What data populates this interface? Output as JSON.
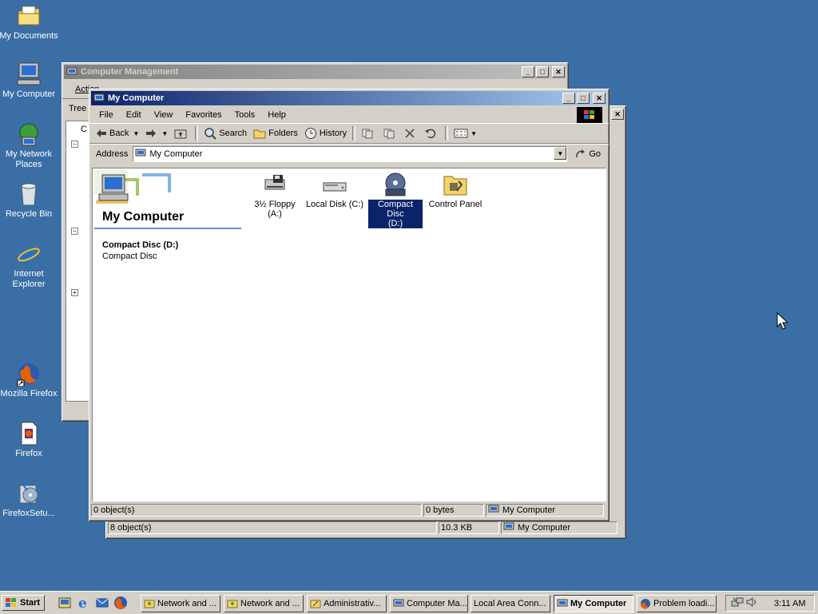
{
  "desktop": {
    "icons": [
      {
        "label": "My Documents",
        "icon": "folder-documents-icon"
      },
      {
        "label": "My Computer",
        "icon": "computer-icon"
      },
      {
        "label": "My Network Places",
        "icon": "network-places-icon"
      },
      {
        "label": "Recycle Bin",
        "icon": "recycle-bin-icon"
      },
      {
        "label": "Internet Explorer",
        "icon": "internet-explorer-icon"
      },
      {
        "label": "Mozilla Firefox",
        "icon": "firefox-icon"
      },
      {
        "label": "Firefox",
        "icon": "firefox-file-icon"
      },
      {
        "label": "FirefoxSetu...",
        "icon": "setup-icon"
      }
    ]
  },
  "computer_management": {
    "title": "Computer Management",
    "toolbar_partial": "Action",
    "tree_label": "Tree",
    "tree_first": "C",
    "status": {
      "objects": "8 object(s)",
      "size": "10.3 KB",
      "location": "My Computer"
    }
  },
  "my_computer": {
    "title": "My Computer",
    "menu": [
      "File",
      "Edit",
      "View",
      "Favorites",
      "Tools",
      "Help"
    ],
    "toolbar": {
      "back": "Back",
      "search": "Search",
      "folders": "Folders",
      "history": "History"
    },
    "address_label": "Address",
    "address_value": "My Computer",
    "go_label": "Go",
    "banner_title": "My Computer",
    "selected_name": "Compact Disc (D:)",
    "selected_type": "Compact Disc",
    "items": [
      {
        "line1": "3½ Floppy",
        "line2": "(A:)",
        "icon": "floppy-drive-icon"
      },
      {
        "line1": "Local Disk (C:)",
        "line2": "",
        "icon": "hard-disk-icon"
      },
      {
        "line1": "Compact Disc",
        "line2": "(D:)",
        "icon": "cd-drive-icon",
        "selected": true
      },
      {
        "line1": "Control Panel",
        "line2": "",
        "icon": "control-panel-icon"
      }
    ],
    "status": {
      "objects": "0 object(s)",
      "size": "0 bytes",
      "location": "My Computer"
    }
  },
  "taskbar": {
    "start": "Start",
    "tasks": [
      {
        "label": "Network and ..."
      },
      {
        "label": "Network and ..."
      },
      {
        "label": "Administrativ..."
      },
      {
        "label": "Computer Ma..."
      },
      {
        "label": "Local Area Conn..."
      },
      {
        "label": "My Computer",
        "active": true
      },
      {
        "label": "Problem loadi..."
      }
    ],
    "clock": "3:11 AM"
  },
  "colors": {
    "desktop": "#3a6ea5",
    "title_active": "#0a246a",
    "selection": "#0a246a"
  }
}
